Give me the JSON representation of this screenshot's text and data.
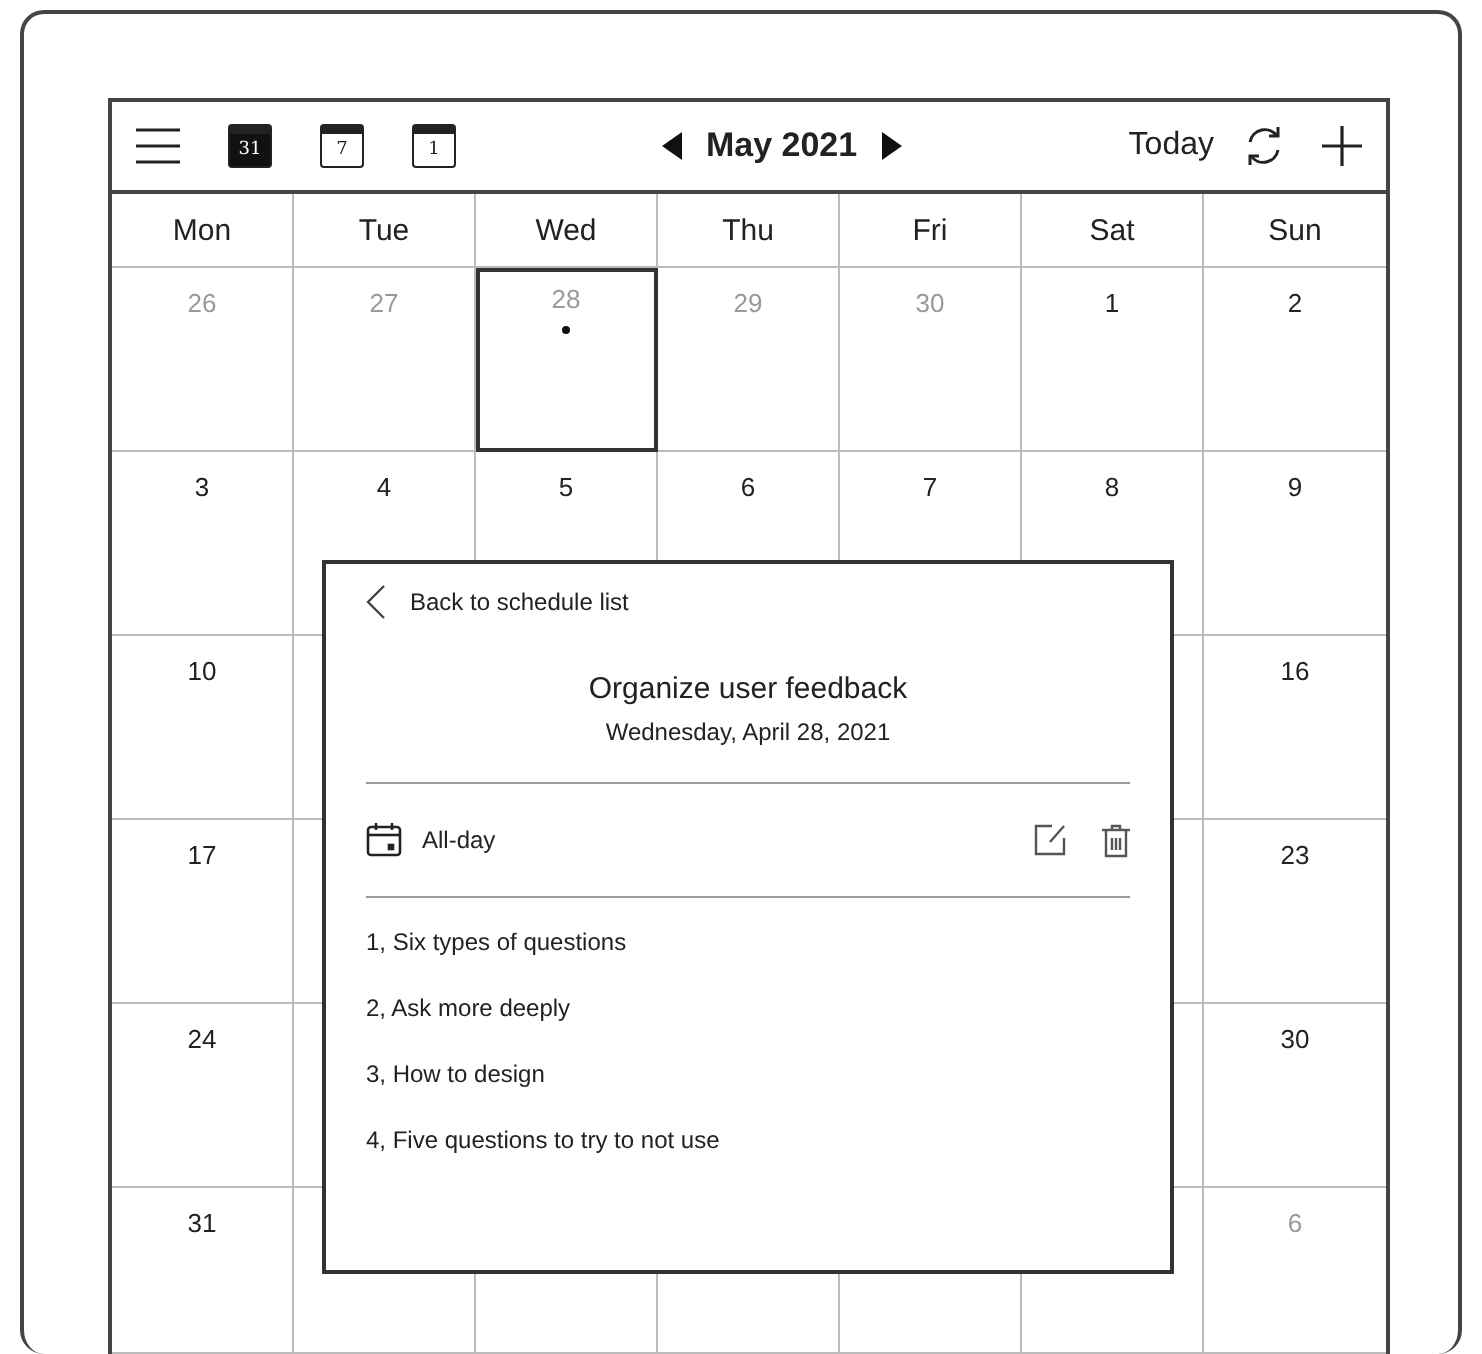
{
  "toolbar": {
    "views": [
      {
        "label": "31",
        "selected": true
      },
      {
        "label": "7",
        "selected": false
      },
      {
        "label": "1",
        "selected": false
      }
    ],
    "month": "May 2021",
    "today": "Today"
  },
  "weekdays": [
    "Mon",
    "Tue",
    "Wed",
    "Thu",
    "Fri",
    "Sat",
    "Sun"
  ],
  "weeks": [
    {
      "days": [
        {
          "day": "26",
          "muted": true,
          "selected": false,
          "has_event": false
        },
        {
          "day": "27",
          "muted": true,
          "selected": false,
          "has_event": false
        },
        {
          "day": "28",
          "muted": true,
          "selected": true,
          "has_event": true
        },
        {
          "day": "29",
          "muted": true,
          "selected": false,
          "has_event": false
        },
        {
          "day": "30",
          "muted": true,
          "selected": false,
          "has_event": false
        },
        {
          "day": "1",
          "muted": false,
          "selected": false,
          "has_event": false
        },
        {
          "day": "2",
          "muted": false,
          "selected": false,
          "has_event": false
        }
      ]
    },
    {
      "days": [
        {
          "day": "3",
          "muted": false,
          "selected": false,
          "has_event": false
        },
        {
          "day": "4",
          "muted": false,
          "selected": false,
          "has_event": false
        },
        {
          "day": "5",
          "muted": false,
          "selected": false,
          "has_event": false
        },
        {
          "day": "6",
          "muted": false,
          "selected": false,
          "has_event": false
        },
        {
          "day": "7",
          "muted": false,
          "selected": false,
          "has_event": false
        },
        {
          "day": "8",
          "muted": false,
          "selected": false,
          "has_event": false
        },
        {
          "day": "9",
          "muted": false,
          "selected": false,
          "has_event": false
        }
      ]
    },
    {
      "first": {
        "day": "10",
        "muted": false,
        "selected": false,
        "has_event": false
      },
      "last": {
        "day": "16",
        "muted": false,
        "selected": false,
        "has_event": false
      }
    },
    {
      "first": {
        "day": "17",
        "muted": false,
        "selected": false,
        "has_event": false
      },
      "last": {
        "day": "23",
        "muted": false,
        "selected": false,
        "has_event": false
      }
    },
    {
      "first": {
        "day": "24",
        "muted": false,
        "selected": false,
        "has_event": false
      },
      "last": {
        "day": "30",
        "muted": false,
        "selected": false,
        "has_event": false
      }
    },
    {
      "first": {
        "day": "31",
        "muted": false,
        "selected": false,
        "has_event": false
      },
      "last": {
        "day": "6",
        "muted": true,
        "selected": false,
        "has_event": false
      }
    }
  ],
  "popup": {
    "back": "Back to schedule list",
    "title": "Organize user feedback",
    "date": "Wednesday, April 28, 2021",
    "time": "All-day",
    "notes": [
      "1, Six types of questions",
      "2, Ask more deeply",
      "3, How to design",
      "4, Five questions to try to not use"
    ]
  }
}
